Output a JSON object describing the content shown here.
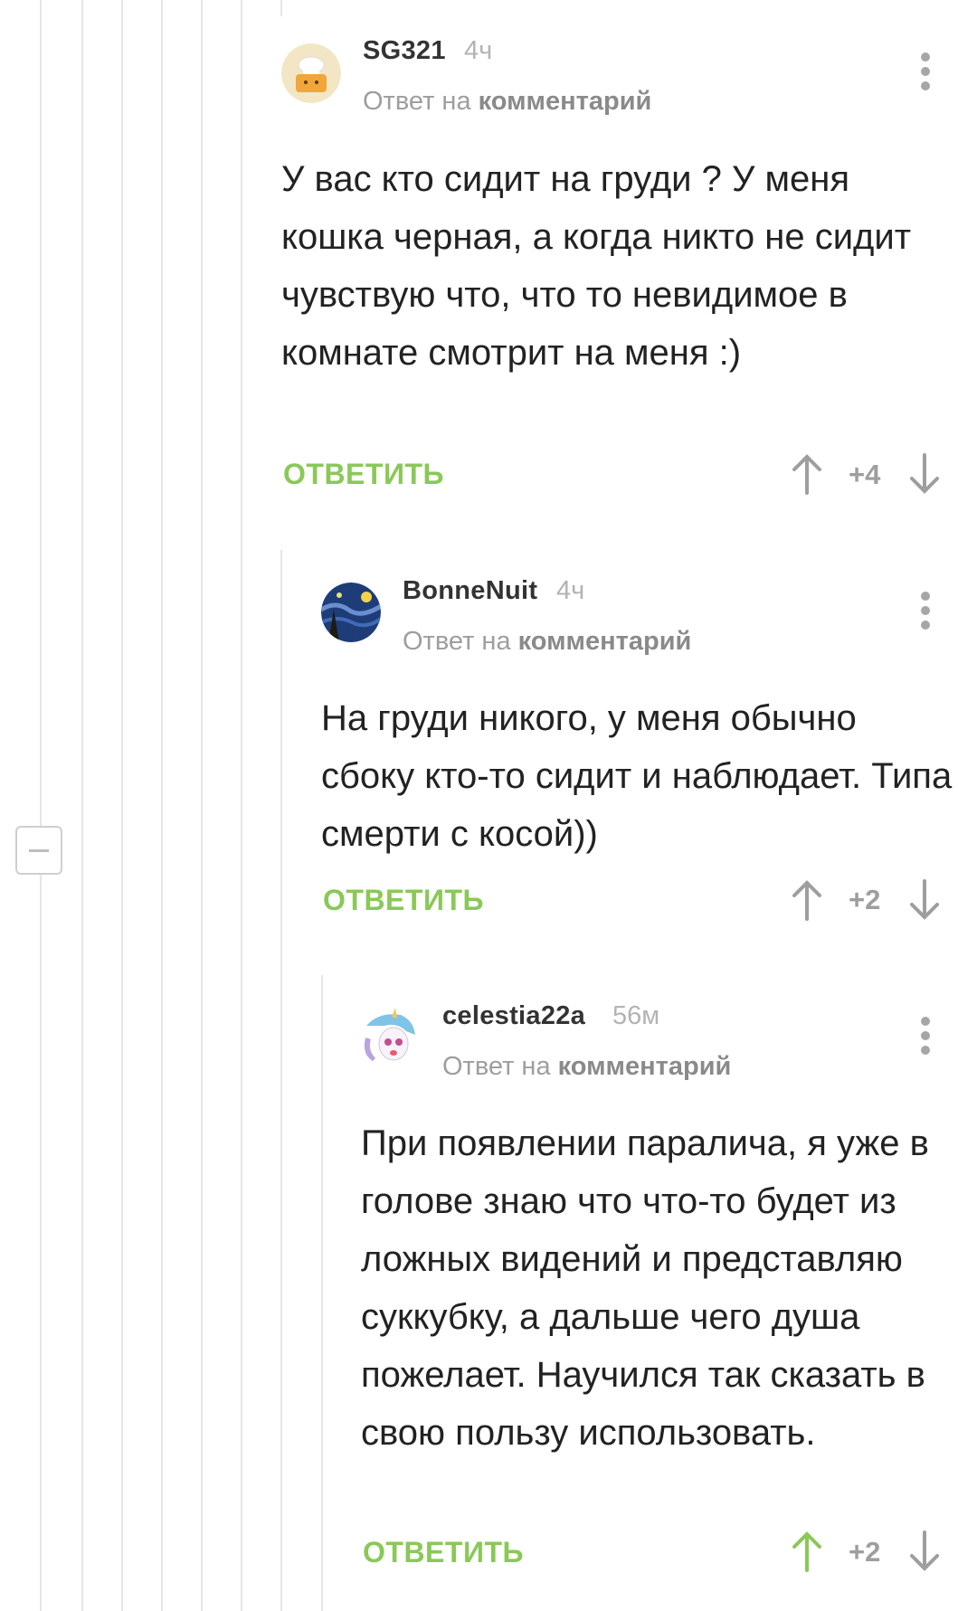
{
  "comments": [
    {
      "author": "SG321",
      "time": "4ч",
      "reply_prefix": "Ответ на",
      "reply_link": "комментарий",
      "text": "У вас кто сидит на груди ? У меня кошка черная, а когда никто не сидит чувствую что, что то невидимое в комнате смотрит на меня :)",
      "reply_label": "ОТВЕТИТЬ",
      "rating": "+4",
      "avatar_icon": "chef-avatar-icon"
    },
    {
      "author": "BonneNuit",
      "time": "4ч",
      "reply_prefix": "Ответ на",
      "reply_link": "комментарий",
      "text": "На груди никого, у меня обычно сбоку кто-то сидит и наблюдает. Типа смерти с косой))",
      "reply_label": "ОТВЕТИТЬ",
      "rating": "+2",
      "avatar_icon": "starry-night-avatar-icon"
    },
    {
      "author": "celestia22a",
      "time": "56м",
      "reply_prefix": "Ответ на",
      "reply_link": "комментарий",
      "text": "При появлении паралича, я уже в голове знаю что что-то будет из ложных видений и представляю суккубку, а дальше чего душа пожелает. Научился так сказать в свою пользу использовать.",
      "reply_label": "ОТВЕТИТЬ",
      "rating": "+2",
      "avatar_icon": "pony-avatar-icon",
      "upvoted": true
    }
  ],
  "colors": {
    "accent_green": "#8ac858",
    "muted_gray": "#9e9e9e",
    "thread_line": "#e6e6e6"
  }
}
